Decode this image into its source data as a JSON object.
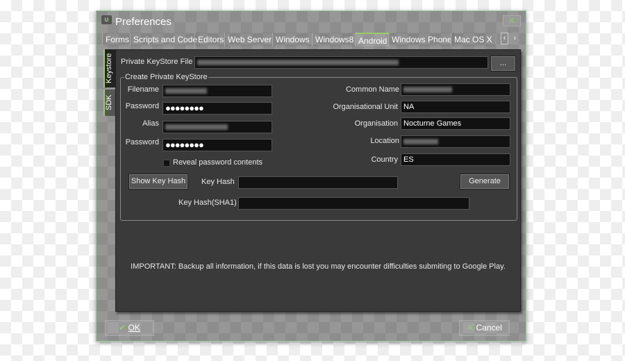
{
  "window": {
    "title": "Preferences",
    "close_icon": "close-icon"
  },
  "tabs": [
    "Forms",
    "Scripts and Code",
    "Editors",
    "Web Server",
    "Windows",
    "Windows8",
    "Android",
    "Windows Phone",
    "Mac OS X"
  ],
  "active_tab": "Android",
  "side_tabs": [
    "Keystore",
    "SDK"
  ],
  "keystore": {
    "file_label": "Private KeyStore File",
    "browse_label": "...",
    "group_title": "Create Private KeyStore",
    "filename_label": "Filename",
    "password_label": "Password",
    "password_value": "●●●●●●●●",
    "alias_label": "Alias",
    "password2_label": "Password",
    "password2_value": "●●●●●●●●",
    "reveal_label": "Reveal password contents",
    "reveal_checked": false,
    "common_name_label": "Common Name",
    "org_unit_label": "Organisational Unit",
    "org_unit_value": "NA",
    "org_label": "Organisation",
    "org_value": "Nocturne Games",
    "location_label": "Location",
    "country_label": "Country",
    "country_value": "ES",
    "show_key_hash_label": "Show Key Hash",
    "key_hash_label": "Key Hash",
    "generate_label": "Generate",
    "key_hash_sha1_label": "Key Hash(SHA1)",
    "important": "IMPORTANT: Backup all information, if this data is lost you may encounter difficulties submiting to Google Play."
  },
  "footer": {
    "ok_label": "OK",
    "cancel_label": "Cancel"
  },
  "colors": {
    "accent": "#99cc66"
  }
}
